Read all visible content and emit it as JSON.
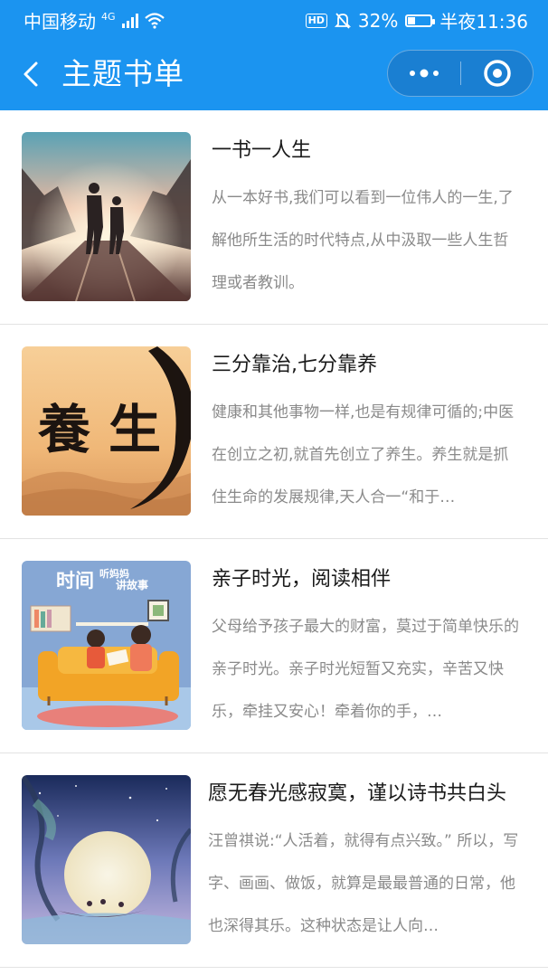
{
  "status_bar": {
    "carrier": "中国移动",
    "network": "4G",
    "hd": "HD",
    "battery_percent": "32%",
    "battery_level": 0.32,
    "time": "半夜11:36"
  },
  "nav": {
    "title": "主题书单",
    "background_color": "#1b94f0"
  },
  "books": [
    {
      "title": "一书一人生",
      "description": "从一本好书,我们可以看到一位伟人的一生,了解他所生活的时代特点,从中汲取一些人生哲理或者教训。"
    },
    {
      "title": "三分靠治,七分靠养",
      "description": "健康和其他事物一样,也是有规律可循的;中医在创立之初,就首先创立了养生。养生就是抓住生命的发展规律,天人合一“和于…",
      "cover_text": [
        "養",
        "生"
      ]
    },
    {
      "title": "亲子时光，阅读相伴",
      "description": "父母给予孩子最大的财富，莫过于简单快乐的亲子时光。亲子时光短暂又充实，辛苦又快乐，牵挂又安心！牵着你的手，…",
      "cover_text": [
        "时间",
        "听妈妈",
        "讲故事"
      ]
    },
    {
      "title": "愿无春光感寂寞，谨以诗书共白头",
      "description": "汪曾祺说:“人活着，就得有点兴致。” 所以，写字、画画、做饭，就算是最最普通的日常，他也深得其乐。这种状态是让人向…"
    }
  ]
}
